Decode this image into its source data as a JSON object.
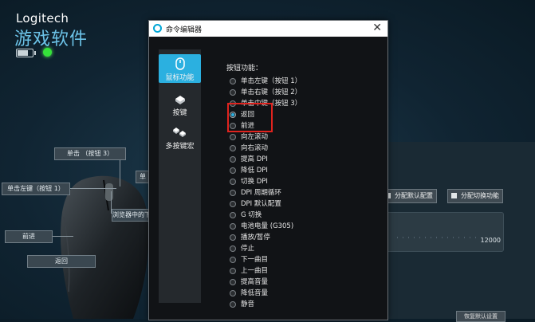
{
  "app": {
    "brand": "Logitech",
    "product": "游戏软件",
    "battery_level": 0.8,
    "status_color": "#35e23a",
    "accent": "#2bb0e0"
  },
  "callouts": {
    "single_btn3": "单击 （按钮 3）",
    "left_btn1": "单击左键（按钮 1）",
    "right_partial": "单",
    "wheel_mid": "浏览器中的下",
    "forward": "前进",
    "back": "返回"
  },
  "bg_panel": {
    "assign_default": "分配默认配置",
    "assign_toggle": "分配切换功能",
    "dpi_max": "12000",
    "bottom_btn": "恢复默认设置"
  },
  "dialog": {
    "title": "命令编辑器",
    "close_icon": "close-icon",
    "sidebar": [
      {
        "label": "鼠标功能",
        "icon": "mouse-icon",
        "active": true
      },
      {
        "label": "按键",
        "icon": "key-icon",
        "active": false
      },
      {
        "label": "多按键宏",
        "icon": "multikey-icon",
        "active": false
      }
    ],
    "section_label": "按钮功能：",
    "options": [
      {
        "label": "单击左键（按钮 1）",
        "selected": false
      },
      {
        "label": "单击右键（按钮 2）",
        "selected": false
      },
      {
        "label": "单击中键（按钮 3）",
        "selected": false
      },
      {
        "label": "返回",
        "selected": true
      },
      {
        "label": "前进",
        "selected": false
      },
      {
        "label": "向左滚动",
        "selected": false
      },
      {
        "label": "向右滚动",
        "selected": false
      },
      {
        "label": "提高 DPI",
        "selected": false
      },
      {
        "label": "降低 DPI",
        "selected": false
      },
      {
        "label": "切换 DPI",
        "selected": false
      },
      {
        "label": "DPI 周期循环",
        "selected": false
      },
      {
        "label": "DPI 默认配置",
        "selected": false
      },
      {
        "label": "G 切换",
        "selected": false
      },
      {
        "label": "电池电量 (G305)",
        "selected": false
      },
      {
        "label": "播放/暂停",
        "selected": false
      },
      {
        "label": "停止",
        "selected": false
      },
      {
        "label": "下一曲目",
        "selected": false
      },
      {
        "label": "上一曲目",
        "selected": false
      },
      {
        "label": "提高音量",
        "selected": false
      },
      {
        "label": "降低音量",
        "selected": false
      },
      {
        "label": "静音",
        "selected": false
      }
    ]
  }
}
